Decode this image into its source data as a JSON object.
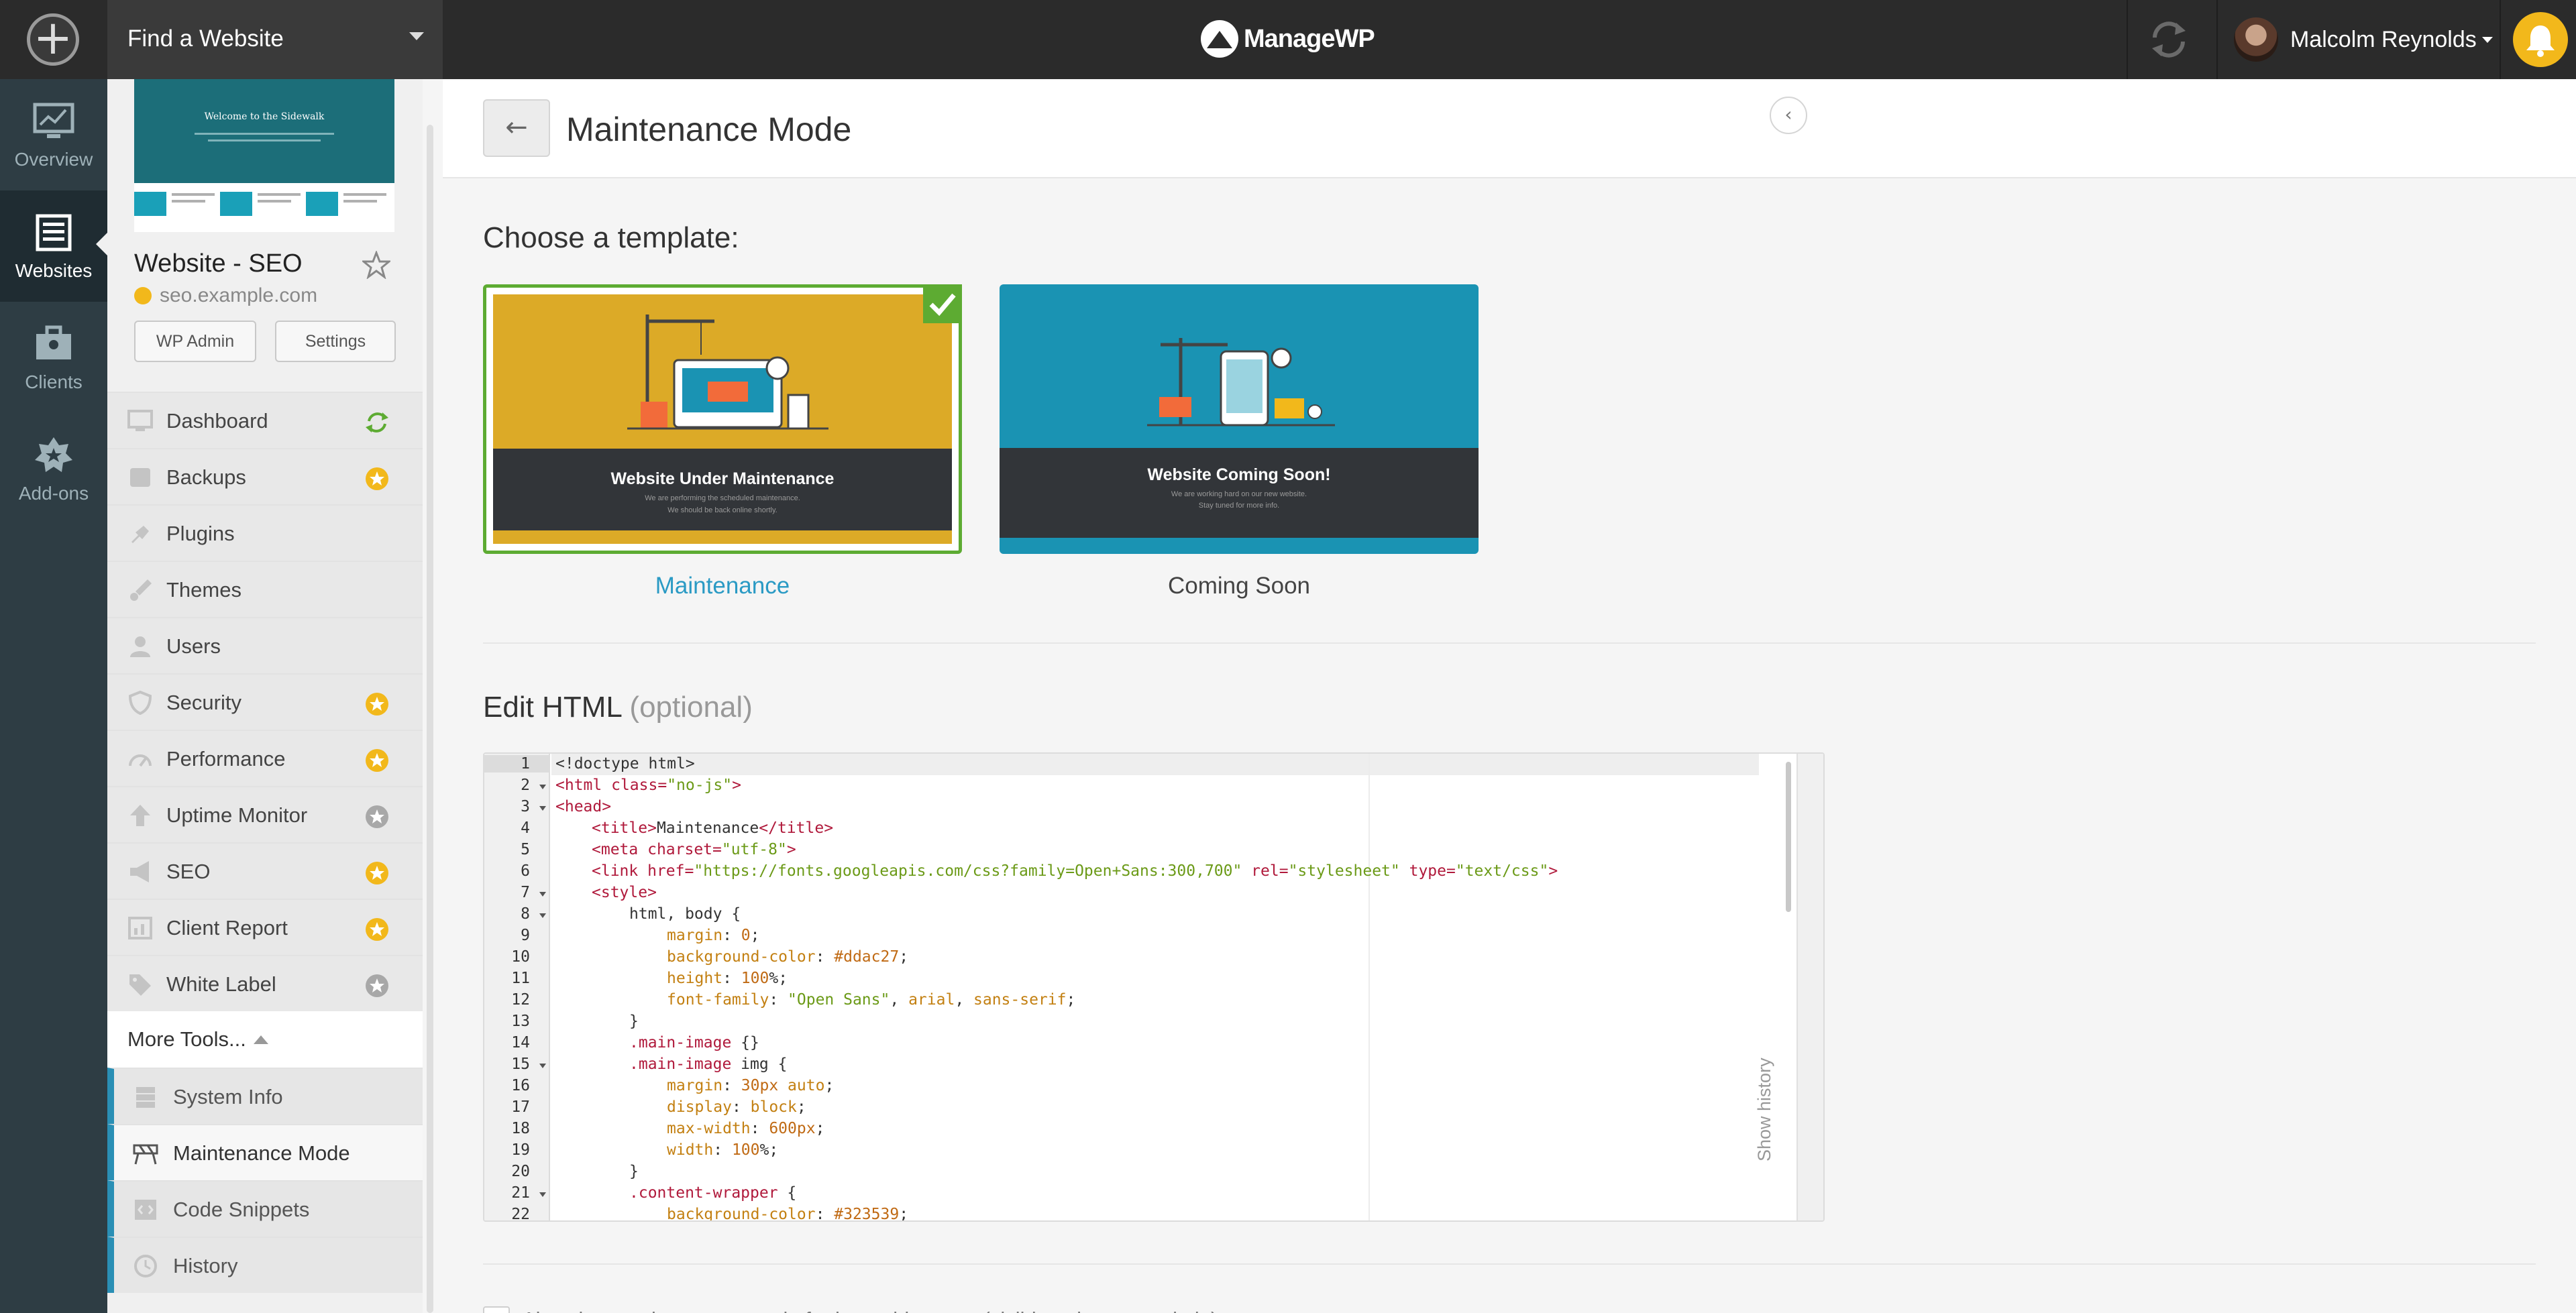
{
  "topbar": {
    "find_website_label": "Find a Website",
    "logo_text": "ManageWP",
    "user_name": "Malcolm Reynolds",
    "notification_color": "#f2b81b"
  },
  "leftnav": {
    "items": [
      {
        "label": "Overview",
        "icon": "chart-monitor-icon"
      },
      {
        "label": "Websites",
        "icon": "websites-list-icon",
        "active": true
      },
      {
        "label": "Clients",
        "icon": "clients-icon"
      },
      {
        "label": "Add-ons",
        "icon": "addons-star-icon"
      }
    ]
  },
  "site": {
    "title": "Website - SEO",
    "url": "seo.example.com",
    "wp_admin_label": "WP Admin",
    "settings_label": "Settings",
    "thumb_heading": "Welcome to the Sidewalk"
  },
  "sidebar_menu": [
    {
      "label": "Dashboard",
      "icon": "monitor-icon",
      "badge": "sync-green-icon"
    },
    {
      "label": "Backups",
      "icon": "backup-icon",
      "badge": "gold-gear-icon"
    },
    {
      "label": "Plugins",
      "icon": "plug-icon",
      "badge": ""
    },
    {
      "label": "Themes",
      "icon": "brush-icon",
      "badge": ""
    },
    {
      "label": "Users",
      "icon": "user-icon",
      "badge": ""
    },
    {
      "label": "Security",
      "icon": "shield-icon",
      "badge": "gold-gear-icon"
    },
    {
      "label": "Performance",
      "icon": "gauge-icon",
      "badge": "gold-gear-icon"
    },
    {
      "label": "Uptime Monitor",
      "icon": "arrow-up-icon",
      "badge": "gray-gear-icon"
    },
    {
      "label": "SEO",
      "icon": "megaphone-icon",
      "badge": "gold-gear-icon"
    },
    {
      "label": "Client Report",
      "icon": "report-chart-icon",
      "badge": "gold-gear-icon"
    },
    {
      "label": "White Label",
      "icon": "tag-icon",
      "badge": "gray-gear-icon"
    }
  ],
  "more_tools": {
    "label": "More Tools...",
    "items": [
      {
        "label": "System Info",
        "icon": "server-icon"
      },
      {
        "label": "Maintenance Mode",
        "icon": "barrier-icon",
        "active": true
      },
      {
        "label": "Code Snippets",
        "icon": "code-icon"
      },
      {
        "label": "History",
        "icon": "clock-icon"
      }
    ]
  },
  "page": {
    "title": "Maintenance Mode",
    "choose_template": "Choose a template:",
    "edit_html": "Edit HTML",
    "edit_html_optional": "(optional)",
    "show_history": "Show history",
    "bottom_text": "Also show maintenance mode for logged-in users (visible only as an admin)"
  },
  "templates": [
    {
      "name": "Maintenance",
      "heading": "Website Under Maintenance",
      "line1": "We are performing the scheduled maintenance.",
      "line2": "We should be back online shortly.",
      "bg": "#dcaa27",
      "selected": true
    },
    {
      "name": "Coming Soon",
      "heading": "Website Coming Soon!",
      "line1": "We are working hard on our new website.",
      "line2": "Stay tuned for more info.",
      "bg": "#1a93b3",
      "selected": false
    }
  ],
  "code_lines": [
    "1",
    "2",
    "3",
    "4",
    "5",
    "6",
    "7",
    "8",
    "9",
    "10",
    "11",
    "12",
    "13",
    "14",
    "15",
    "16",
    "17",
    "18",
    "19",
    "20",
    "21",
    "22"
  ],
  "code": {
    "l1": "<!doctype html>",
    "l2a": "<html ",
    "l2b": "class=",
    "l2c": "\"no-js\"",
    "l2d": ">",
    "l3": "<head>",
    "l4a": "<title>",
    "l4b": "Maintenance",
    "l4c": "</title>",
    "l5a": "<meta ",
    "l5b": "charset=",
    "l5c": "\"utf-8\"",
    "l5d": ">",
    "l6a": "<link ",
    "l6b": "href=",
    "l6c": "\"https://fonts.googleapis.com/css?family=Open+Sans:300,700\"",
    "l6d": " rel=",
    "l6e": "\"stylesheet\"",
    "l6f": " type=",
    "l6g": "\"text/css\"",
    "l6h": ">",
    "l7": "<style>",
    "l8": "html, body {",
    "l9a": "margin",
    "l9b": ": ",
    "l9c": "0",
    "l9d": ";",
    "l10a": "background-color",
    "l10b": ": ",
    "l10c": "#ddac27",
    "l10d": ";",
    "l11a": "height",
    "l11b": ": ",
    "l11c": "100",
    "l11d": "%;",
    "l12a": "font-family",
    "l12b": ": ",
    "l12c": "\"Open Sans\"",
    "l12d": ", ",
    "l12e": "arial",
    "l12f": ", ",
    "l12g": "sans-serif",
    "l12h": ";",
    "l13": "}",
    "l14a": ".main-image",
    "l14b": " {}",
    "l15a": ".main-image",
    "l15b": " img {",
    "l16a": "margin",
    "l16b": ": ",
    "l16c": "30",
    "l16d": "px ",
    "l16e": "auto",
    "l16f": ";",
    "l17a": "display",
    "l17b": ": ",
    "l17c": "block",
    "l17d": ";",
    "l18a": "max-width",
    "l18b": ": ",
    "l18c": "600",
    "l18d": "px",
    "l18e": ";",
    "l19a": "width",
    "l19b": ": ",
    "l19c": "100",
    "l19d": "%;",
    "l20": "}",
    "l21a": ".content-wrapper",
    "l21b": " {",
    "l22a": "background-color",
    "l22b": ": ",
    "l22c": "#323539",
    "l22d": ";"
  }
}
